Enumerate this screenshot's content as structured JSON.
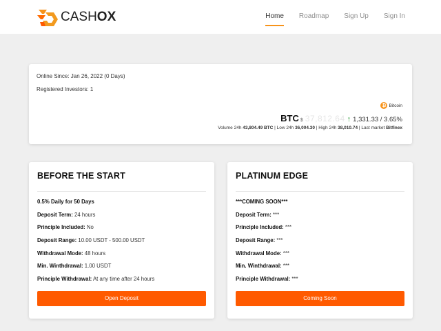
{
  "header": {
    "logo": {
      "text_prefix": "CASH",
      "text_suffix": "OX",
      "icon": "cashox-logo-icon"
    },
    "nav": [
      {
        "label": "Home",
        "active": true
      },
      {
        "label": "Roadmap",
        "active": false
      },
      {
        "label": "Sign Up",
        "active": false
      },
      {
        "label": "Sign In",
        "active": false
      }
    ]
  },
  "info": {
    "online_since": "Online Since: Jan 26, 2022 (0 Days)",
    "registered_investors": "Registered Investors: 1"
  },
  "ticker": {
    "brand_icon": "bitcoin-icon",
    "brand": "Bitcoin",
    "symbol": "BTC",
    "currency": "$",
    "price": "37,812.64",
    "trend_icon": "arrow-up-icon",
    "change": "1,331.33 / 3.65%",
    "volume_label": "Volume 24h",
    "volume": "43,804.49 BTC",
    "low_label": "Low 24h",
    "low": "36,004.30",
    "high_label": "High 24h",
    "high": "38,010.74",
    "market_label": "Last market",
    "market": "Bitfinex",
    "accent_color": "#f7931a",
    "up_color": "#2e9b3a"
  },
  "plans": [
    {
      "title": "BEFORE THE START",
      "rows": [
        {
          "key": "0.5% Daily for 50 Days",
          "value": ""
        },
        {
          "key": "Deposit Term:",
          "value": " 24 hours"
        },
        {
          "key": "Principle Included:",
          "value": " No"
        },
        {
          "key": "Deposit Range:",
          "value": " 10.00 USDT - 500.00 USDT"
        },
        {
          "key": "Withdrawal Mode:",
          "value": " 48 hours"
        },
        {
          "key": "Min. Winthdrawal:",
          "value": " 1.00 USDT"
        },
        {
          "key": "Principle Withdrawal:",
          "value": " At any time after 24 hours"
        }
      ],
      "button": "Open Deposit"
    },
    {
      "title": "PLATINUM EDGE",
      "rows": [
        {
          "key": "***COMING SOON***",
          "value": ""
        },
        {
          "key": "Deposit Term:",
          "value": " ***"
        },
        {
          "key": "Principle Included:",
          "value": " ***"
        },
        {
          "key": "Deposit Range:",
          "value": " ***"
        },
        {
          "key": "Withdrawal Mode:",
          "value": " ***"
        },
        {
          "key": "Min. Winthdrawal:",
          "value": " ***"
        },
        {
          "key": "Principle Withdrawal:",
          "value": " ***"
        }
      ],
      "button": "Coming Soon"
    }
  ],
  "colors": {
    "button": "#ff5a00",
    "nav_accent": "#f7931a"
  }
}
